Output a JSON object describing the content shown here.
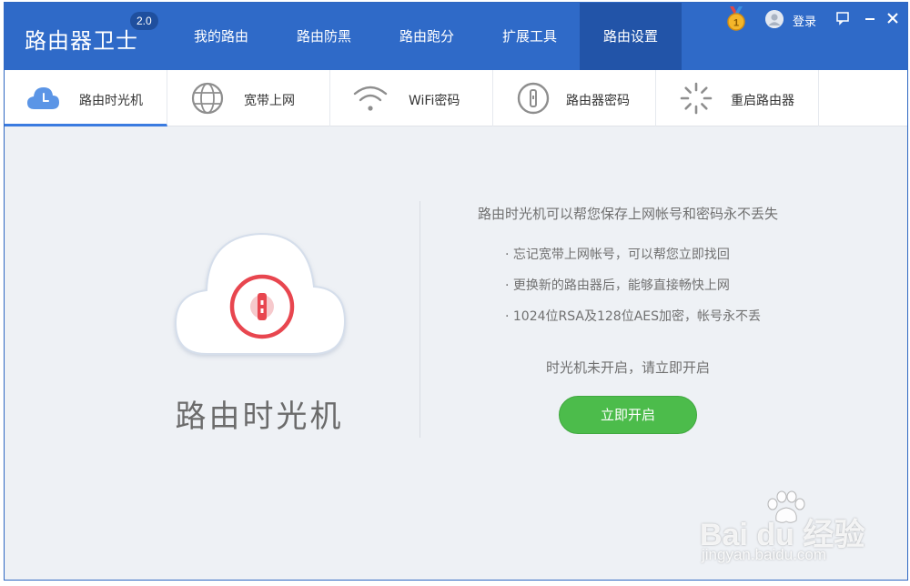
{
  "app": {
    "title": "路由器卫士",
    "version": "2.0"
  },
  "nav": {
    "tabs": [
      {
        "label": "我的路由"
      },
      {
        "label": "路由防黑"
      },
      {
        "label": "路由跑分"
      },
      {
        "label": "扩展工具"
      },
      {
        "label": "路由设置"
      }
    ],
    "active": "路由设置"
  },
  "header": {
    "login_label": "登录",
    "icons": [
      "medal-icon",
      "avatar-icon",
      "feedback-icon",
      "minimize-icon",
      "close-icon"
    ]
  },
  "toolbar": {
    "tabs": [
      {
        "label": "路由时光机",
        "icon": "clock-cloud-icon"
      },
      {
        "label": "宽带上网",
        "icon": "globe-icon"
      },
      {
        "label": "WiFi密码",
        "icon": "wifi-icon"
      },
      {
        "label": "路由器密码",
        "icon": "key-icon"
      },
      {
        "label": "重启路由器",
        "icon": "restart-icon"
      }
    ],
    "active": "路由时光机"
  },
  "main": {
    "feature_title": "路由时光机",
    "intro": "路由时光机可以帮您保存上网帐号和密码永不丢失",
    "bullets": [
      "· 忘记宽带上网帐号，可以帮您立即找回",
      "· 更换新的路由器后，能够直接畅快上网",
      "· 1024位RSA及128位AES加密，帐号永不丢"
    ],
    "status": "时光机未开启，请立即开启",
    "enable_button": "立即开启"
  },
  "watermark": {
    "main": "Bai du 经验",
    "sub": "jingyan.baidu.com"
  },
  "colors": {
    "title_bar": "#2f6ac8",
    "active_nav": "#2254a8",
    "accent_blue": "#3a7be0",
    "button_green": "#4cbc4b",
    "lock_red": "#e8464f",
    "content_bg": "#eef1f5"
  }
}
